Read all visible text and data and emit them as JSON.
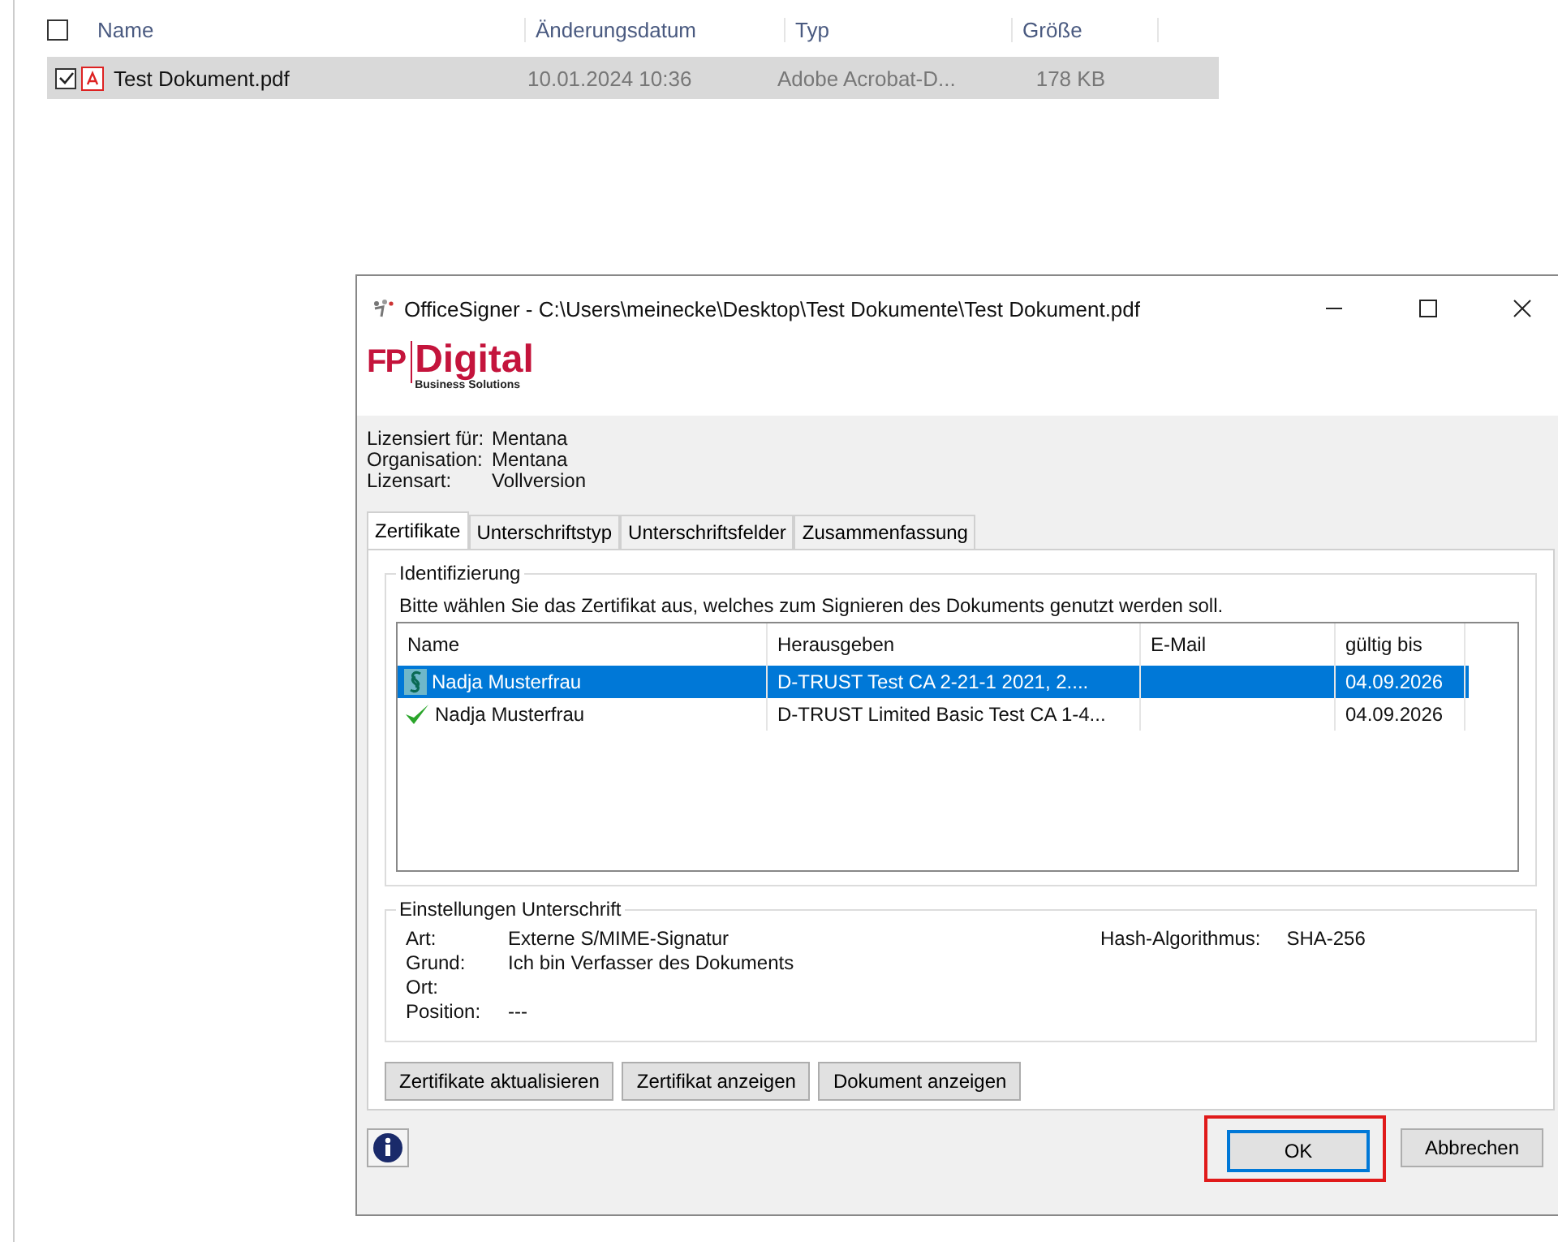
{
  "explorer": {
    "header_checked": false,
    "columns": [
      "Name",
      "Änderungsdatum",
      "Typ",
      "Größe"
    ],
    "rows": [
      {
        "checked": true,
        "selected": true,
        "name": "Test Dokument.pdf",
        "date": "10.01.2024 10:36",
        "type": "Adobe Acrobat-D...",
        "size": "178 KB"
      }
    ]
  },
  "dialog": {
    "title": "OfficeSigner - C:\\Users\\meinecke\\Desktop\\Test Dokumente\\Test Dokument.pdf",
    "logo": {
      "mark": "FP",
      "name": "Digital",
      "tagline": "Business Solutions"
    },
    "license": [
      {
        "label": "Lizensiert für:",
        "value": "Mentana"
      },
      {
        "label": "Organisation:",
        "value": "Mentana"
      },
      {
        "label": "Lizensart:",
        "value": "Vollversion"
      }
    ],
    "tabs": [
      {
        "label": "Zertifikate",
        "selected": true
      },
      {
        "label": "Unterschriftstyp",
        "selected": false
      },
      {
        "label": "Unterschriftsfelder",
        "selected": false
      },
      {
        "label": "Zusammenfassung",
        "selected": false
      }
    ],
    "identification": {
      "legend": "Identifizierung",
      "instruction": "Bitte wählen Sie das Zertifikat aus, welches zum Signieren des Dokuments genutzt werden soll.",
      "columns": [
        "Name",
        "Herausgeben",
        "E-Mail",
        "gültig bis"
      ],
      "rows": [
        {
          "kind": "paragraph",
          "selected": true,
          "name": "Nadja Musterfrau",
          "issuer": "D-TRUST Test CA 2-21-1 2021, 2....",
          "valid_until": "04.09.2026"
        },
        {
          "kind": "check",
          "selected": false,
          "name": "Nadja Musterfrau",
          "issuer": "D-TRUST Limited Basic Test CA 1-4...",
          "valid_until": "04.09.2026"
        }
      ]
    },
    "settings": {
      "legend": "Einstellungen Unterschrift",
      "fields": [
        {
          "label": "Art:",
          "value": "Externe S/MIME-Signatur"
        },
        {
          "label": "Grund:",
          "value": "Ich bin Verfasser des Dokuments"
        },
        {
          "label": "Ort:"
        },
        {
          "label": "Position:",
          "value": "---"
        }
      ],
      "hash": {
        "label": "Hash-Algorithmus:",
        "value": "SHA-256"
      }
    },
    "actions": [
      "Zertifikate aktualisieren",
      "Zertifikat anzeigen",
      "Dokument anzeigen"
    ],
    "footer_buttons": [
      {
        "label": "OK",
        "default": true,
        "highlighted": true
      },
      {
        "label": "Abbrechen",
        "default": false,
        "highlighted": false
      }
    ]
  }
}
